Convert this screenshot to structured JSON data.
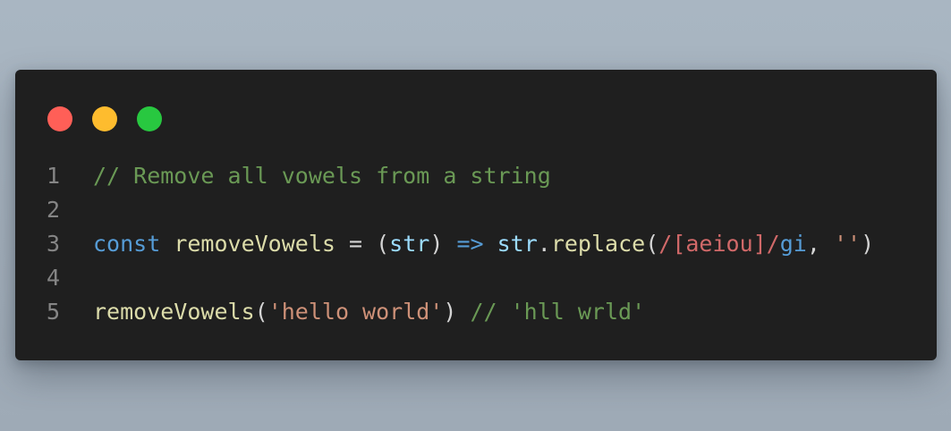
{
  "window": {
    "controls": [
      {
        "name": "close",
        "color": "#ff5f57"
      },
      {
        "name": "minimize",
        "color": "#febc2e"
      },
      {
        "name": "zoom",
        "color": "#28c840"
      }
    ]
  },
  "colors": {
    "background": "#1f1f1f",
    "line_number": "#858585",
    "comment": "#6a9955",
    "keyword": "#569cd6",
    "function": "#dcdcaa",
    "variable": "#9cdcfe",
    "plain": "#d4d4d4",
    "string": "#ce9178",
    "regex": "#d16969"
  },
  "code": {
    "lines": [
      {
        "number": "1",
        "tokens": [
          {
            "text": "// Remove all vowels from a string",
            "kind": "comment"
          }
        ]
      },
      {
        "number": "2",
        "tokens": []
      },
      {
        "number": "3",
        "tokens": [
          {
            "text": "const",
            "kind": "keyword"
          },
          {
            "text": " ",
            "kind": "plain"
          },
          {
            "text": "removeVowels",
            "kind": "function"
          },
          {
            "text": " = (",
            "kind": "plain"
          },
          {
            "text": "str",
            "kind": "variable"
          },
          {
            "text": ") ",
            "kind": "plain"
          },
          {
            "text": "=>",
            "kind": "keyword"
          },
          {
            "text": " ",
            "kind": "plain"
          },
          {
            "text": "str",
            "kind": "variable"
          },
          {
            "text": ".",
            "kind": "plain"
          },
          {
            "text": "replace",
            "kind": "function"
          },
          {
            "text": "(",
            "kind": "plain"
          },
          {
            "text": "/",
            "kind": "regex"
          },
          {
            "text": "[aeiou]",
            "kind": "regex"
          },
          {
            "text": "/",
            "kind": "regex"
          },
          {
            "text": "gi",
            "kind": "keyword"
          },
          {
            "text": ", ",
            "kind": "plain"
          },
          {
            "text": "''",
            "kind": "string"
          },
          {
            "text": ")",
            "kind": "plain"
          }
        ]
      },
      {
        "number": "4",
        "tokens": []
      },
      {
        "number": "5",
        "tokens": [
          {
            "text": "removeVowels",
            "kind": "function"
          },
          {
            "text": "(",
            "kind": "plain"
          },
          {
            "text": "'hello world'",
            "kind": "string"
          },
          {
            "text": ") ",
            "kind": "plain"
          },
          {
            "text": "// 'hll wrld'",
            "kind": "comment"
          }
        ]
      }
    ]
  }
}
